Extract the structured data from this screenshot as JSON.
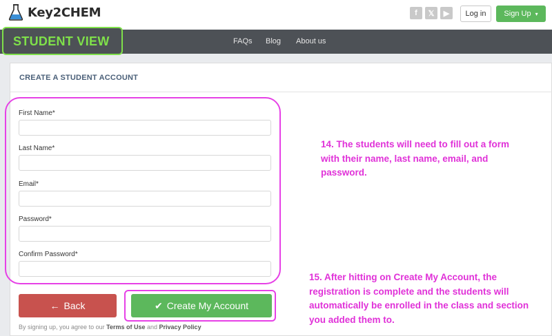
{
  "brand": {
    "name": "Key2CHEM"
  },
  "header": {
    "social": [
      {
        "icon": "facebook-icon",
        "glyph": "f"
      },
      {
        "icon": "x-icon",
        "glyph": "𝕏"
      },
      {
        "icon": "youtube-icon",
        "glyph": "▶"
      }
    ],
    "login_label": "Log in",
    "signup_label": "Sign Up",
    "signup_caret": "▾"
  },
  "nav": {
    "links": [
      "FAQs",
      "Blog",
      "About us"
    ],
    "student_view": "STUDENT VIEW"
  },
  "form": {
    "title": "CREATE A STUDENT ACCOUNT",
    "fields": [
      {
        "label": "First Name*",
        "value": ""
      },
      {
        "label": "Last Name*",
        "value": ""
      },
      {
        "label": "Email*",
        "value": ""
      },
      {
        "label": "Password*",
        "value": ""
      },
      {
        "label": "Confirm Password*",
        "value": ""
      }
    ],
    "back_label": "Back",
    "back_icon": "←",
    "create_label": "Create My Account",
    "create_icon": "✔",
    "terms_prefix": "By signing up, you agree to our",
    "terms_link": "Terms of Use",
    "terms_and": "and",
    "privacy_link": "Privacy Policy"
  },
  "annotations": {
    "note_14": "14. The students will need to fill out a form with their name, last name, email, and password.",
    "note_15": "15. After hitting on Create My Account, the registration is complete and  the students will automatically be enrolled in the class and section you added them to."
  },
  "colors": {
    "accent_green": "#5cb85c",
    "back_red": "#c8524e",
    "annotation_magenta": "#e031d8",
    "student_view_green": "#7fe04a",
    "navbar": "#4d5156"
  }
}
